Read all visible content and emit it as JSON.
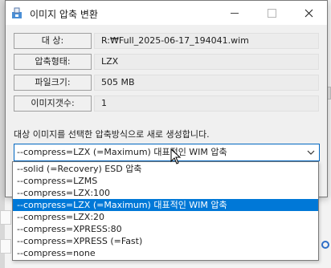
{
  "window": {
    "title": "이미지 압축 변환"
  },
  "info_rows": [
    {
      "label": "대    상:",
      "value": "R:₩Full_2025-06-17_194041.wim"
    },
    {
      "label": "압축형태:",
      "value": "LZX"
    },
    {
      "label": "파일크기:",
      "value": "505 MB"
    },
    {
      "label": "이미지갯수:",
      "value": "1"
    }
  ],
  "instruction": "대상 이미지를 선택한 압축방식으로 새로 생성합니다.",
  "compress_select": {
    "selected": "--compress=LZX (=Maximum) 대표적인 WIM 압축",
    "options": [
      "--solid (=Recovery) ESD 압축",
      "--compress=LZMS",
      "--compress=LZX:100",
      "--compress=LZX (=Maximum) 대표적인 WIM 압축",
      "--compress=LZX:20",
      "--compress=XPRESS:80",
      "--compress=XPRESS (=Fast)",
      "--compress=none"
    ],
    "highlighted_index": 3
  },
  "colors": {
    "accent": "#0078d7",
    "focus_border": "#0067c0"
  },
  "icons": [
    "app-icon",
    "minimize-icon",
    "maximize-icon",
    "close-icon",
    "chevron-down-icon",
    "mouse-cursor-icon"
  ]
}
